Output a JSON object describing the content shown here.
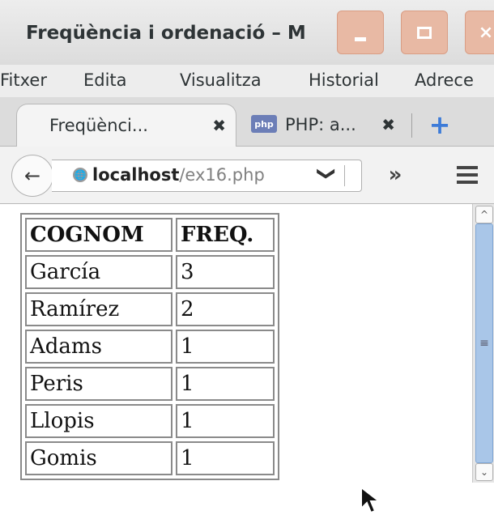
{
  "window": {
    "title": "Freqüència i ordenació – M",
    "minimize_label": "_",
    "close_label": "×"
  },
  "menubar": {
    "items": [
      {
        "label": "Fitxer"
      },
      {
        "label": "Edita"
      },
      {
        "label": "Visualitza"
      },
      {
        "label": "Historial"
      },
      {
        "label": "Adrece"
      }
    ]
  },
  "tabs": [
    {
      "label": "Freqüènci...",
      "active": true
    },
    {
      "label": "PHP: a...",
      "icon": "php-icon",
      "active": false
    }
  ],
  "tab_icons": {
    "php": "php",
    "close": "✖",
    "new_tab": "+"
  },
  "navbar": {
    "back_icon": "←",
    "url_host": "localhost",
    "url_path": "/ex16.php",
    "dropdown_icon": "❯",
    "overflow_icon": "»"
  },
  "table": {
    "headers": [
      "COGNOM",
      "FREQ."
    ],
    "rows": [
      [
        "García",
        "3"
      ],
      [
        "Ramírez",
        "2"
      ],
      [
        "Adams",
        "1"
      ],
      [
        "Peris",
        "1"
      ],
      [
        "Llopis",
        "1"
      ],
      [
        "Gomis",
        "1"
      ]
    ]
  },
  "colors": {
    "accent": "#3d7bd8",
    "scroll_thumb": "#a9c6e8"
  }
}
